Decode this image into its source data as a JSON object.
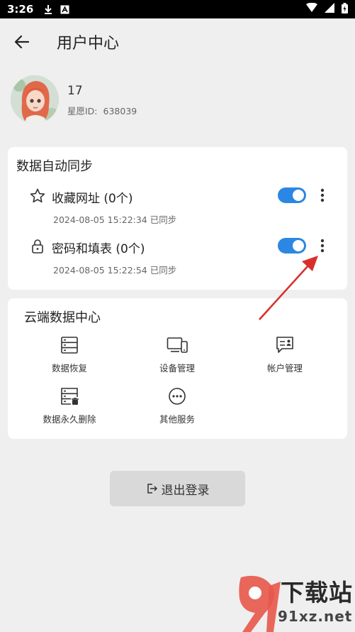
{
  "status_bar": {
    "time": "3:26"
  },
  "header": {
    "title": "用户中心"
  },
  "profile": {
    "username": "17",
    "star_id_label": "星愿ID:",
    "star_id_value": "638039"
  },
  "sync": {
    "title": "数据自动同步",
    "items": [
      {
        "label": "收藏网址 (0个)",
        "time": "2024-08-05 15:22:34 已同步",
        "icon": "star-icon",
        "enabled": true
      },
      {
        "label": "密码和填表 (0个)",
        "time": "2024-08-05 15:22:54 已同步",
        "icon": "lock-icon",
        "enabled": true
      }
    ]
  },
  "cloud": {
    "title": "云端数据中心",
    "items": [
      {
        "label": "数据恢复",
        "icon": "server-restore-icon"
      },
      {
        "label": "设备管理",
        "icon": "devices-icon"
      },
      {
        "label": "帐户管理",
        "icon": "account-card-icon"
      },
      {
        "label": "数据永久删除",
        "icon": "server-delete-icon"
      },
      {
        "label": "其他服务",
        "icon": "more-circle-icon"
      }
    ]
  },
  "logout": {
    "label": "退出登录"
  },
  "watermark": {
    "text1": "下载站",
    "text2": "91xz.net"
  },
  "colors": {
    "accent": "#2b87e3",
    "annotation": "#d9302c",
    "background": "#efefef"
  }
}
